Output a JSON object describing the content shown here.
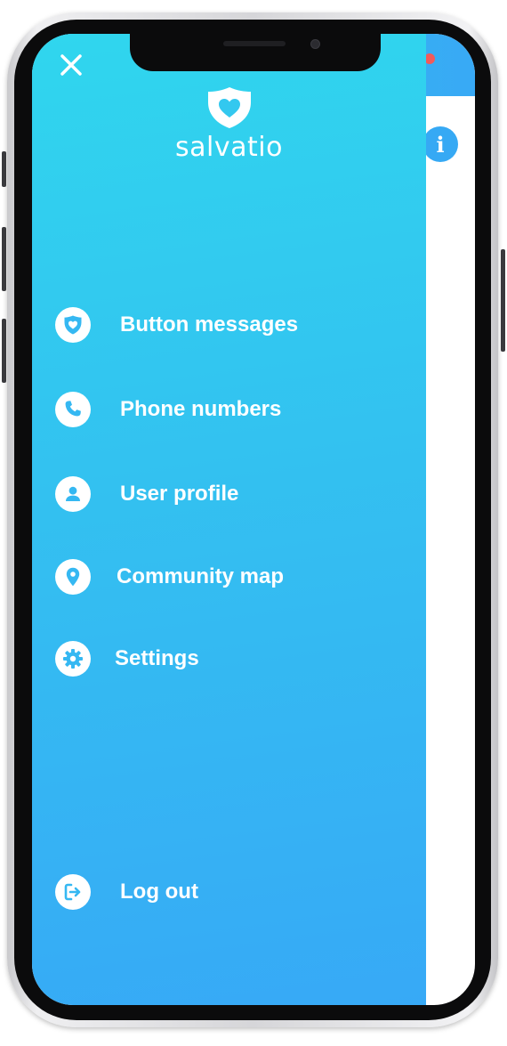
{
  "app": {
    "name": "salvatio",
    "brand_colors": {
      "top": "#30d6ee",
      "bottom": "#37a9f6",
      "text": "#ffffff"
    }
  },
  "drawer": {
    "close_icon": "close-icon",
    "menu": [
      {
        "label": "Button messages",
        "icon": "shield-heart-icon"
      },
      {
        "label": "Phone numbers",
        "icon": "phone-icon"
      },
      {
        "label": "User profile",
        "icon": "user-icon"
      },
      {
        "label": "Community map",
        "icon": "map-pin-icon"
      },
      {
        "label": "Settings",
        "icon": "gear-icon"
      }
    ],
    "logout": {
      "label": "Log out",
      "icon": "logout-icon"
    }
  },
  "background_screen": {
    "info_icon": "info-icon",
    "info_glyph": "i"
  }
}
